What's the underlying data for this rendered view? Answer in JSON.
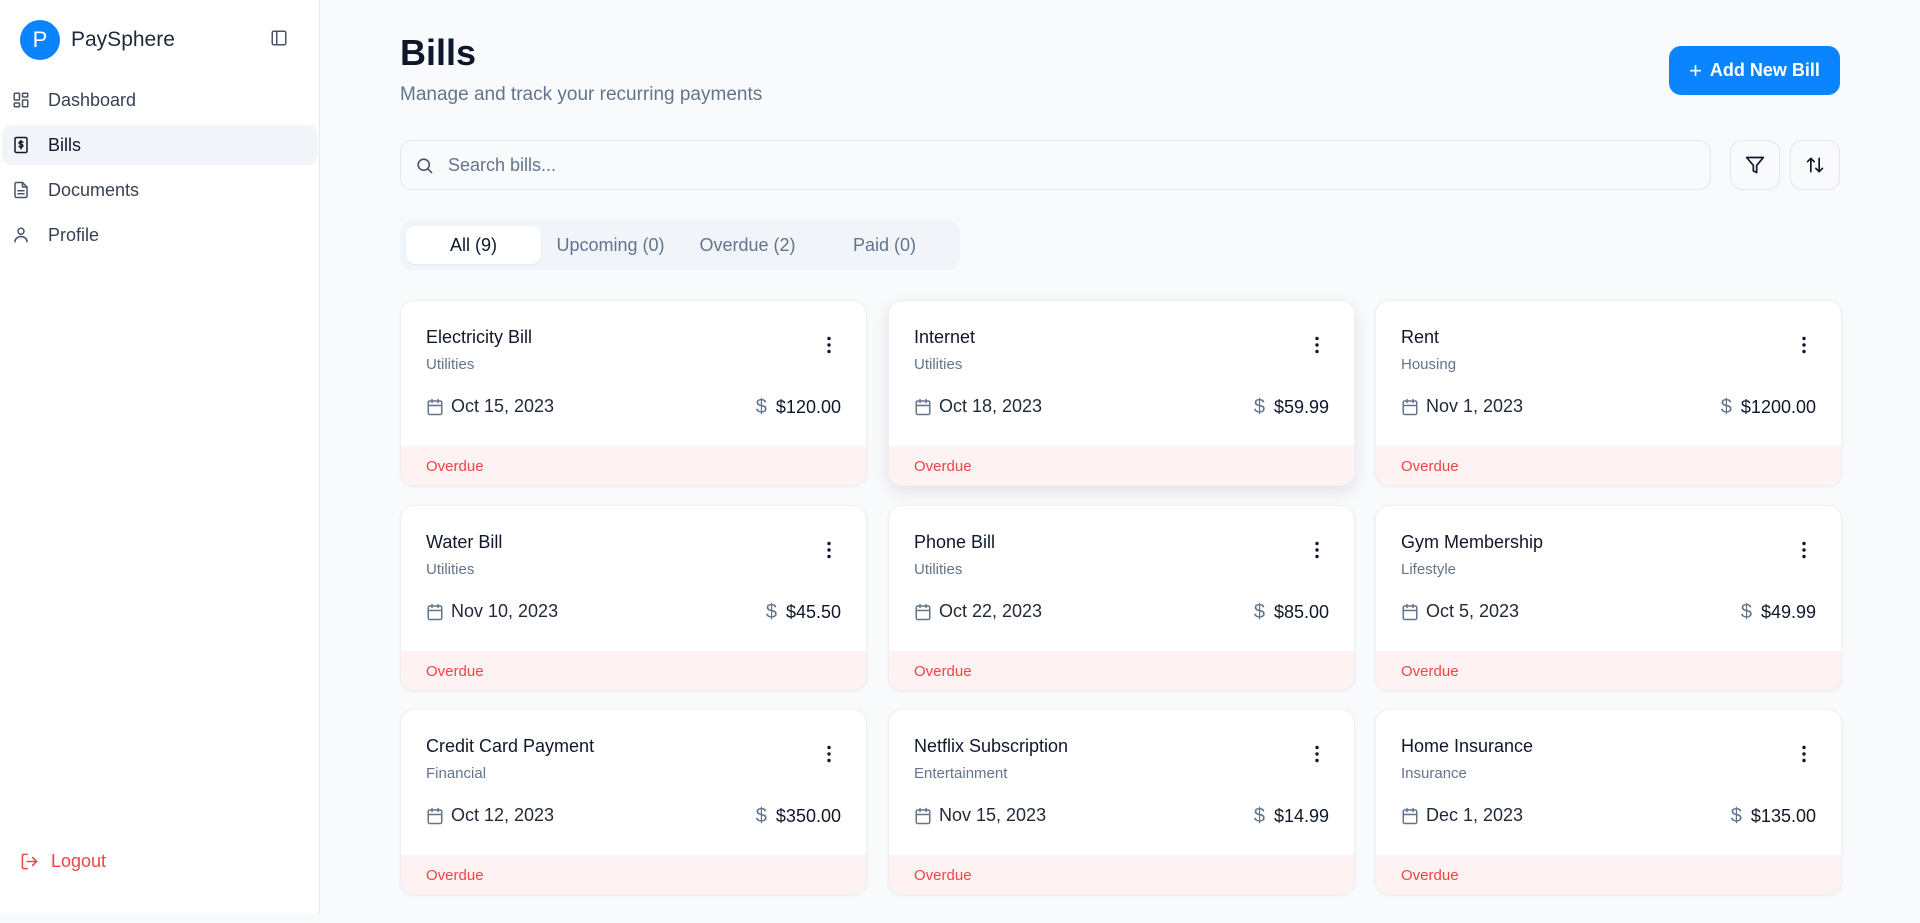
{
  "app": {
    "name": "PaySphere",
    "logo_letter": "P"
  },
  "sidebar": {
    "items": [
      {
        "label": "Dashboard",
        "icon": "dashboard-icon"
      },
      {
        "label": "Bills",
        "icon": "bill-icon",
        "active": true
      },
      {
        "label": "Documents",
        "icon": "document-icon"
      },
      {
        "label": "Profile",
        "icon": "user-icon"
      }
    ],
    "logout_label": "Logout"
  },
  "header": {
    "title": "Bills",
    "subtitle": "Manage and track your recurring payments",
    "add_button_label": "Add New Bill"
  },
  "search": {
    "placeholder": "Search bills...",
    "value": ""
  },
  "tabs": [
    {
      "label": "All (9)",
      "active": true
    },
    {
      "label": "Upcoming (0)"
    },
    {
      "label": "Overdue (2)"
    },
    {
      "label": "Paid (0)"
    }
  ],
  "bills": [
    {
      "title": "Electricity Bill",
      "category": "Utilities",
      "date": "Oct 15, 2023",
      "amount": "$120.00",
      "status": "Overdue"
    },
    {
      "title": "Internet",
      "category": "Utilities",
      "date": "Oct 18, 2023",
      "amount": "$59.99",
      "status": "Overdue"
    },
    {
      "title": "Rent",
      "category": "Housing",
      "date": "Nov 1, 2023",
      "amount": "$1200.00",
      "status": "Overdue"
    },
    {
      "title": "Water Bill",
      "category": "Utilities",
      "date": "Nov 10, 2023",
      "amount": "$45.50",
      "status": "Overdue"
    },
    {
      "title": "Phone Bill",
      "category": "Utilities",
      "date": "Oct 22, 2023",
      "amount": "$85.00",
      "status": "Overdue"
    },
    {
      "title": "Gym Membership",
      "category": "Lifestyle",
      "date": "Oct 5, 2023",
      "amount": "$49.99",
      "status": "Overdue"
    },
    {
      "title": "Credit Card Payment",
      "category": "Financial",
      "date": "Oct 12, 2023",
      "amount": "$350.00",
      "status": "Overdue"
    },
    {
      "title": "Netflix Subscription",
      "category": "Entertainment",
      "date": "Nov 15, 2023",
      "amount": "$14.99",
      "status": "Overdue"
    },
    {
      "title": "Home Insurance",
      "category": "Insurance",
      "date": "Dec 1, 2023",
      "amount": "$135.00",
      "status": "Overdue"
    }
  ],
  "icons": {
    "search": "search-icon",
    "filter": "filter-icon",
    "sort": "sort-icon",
    "calendar": "calendar-icon",
    "dollar": "dollar-icon",
    "menu": "more-vertical-icon",
    "collapse": "sidebar-toggle-icon",
    "logout": "logout-icon",
    "add": "plus-icon"
  },
  "colors": {
    "accent": "#0a84ff",
    "overdue_text": "#ef4444",
    "overdue_bg": "#fef2f2",
    "background": "#f8fafc",
    "sidebar_active": "#f1f5f9"
  }
}
